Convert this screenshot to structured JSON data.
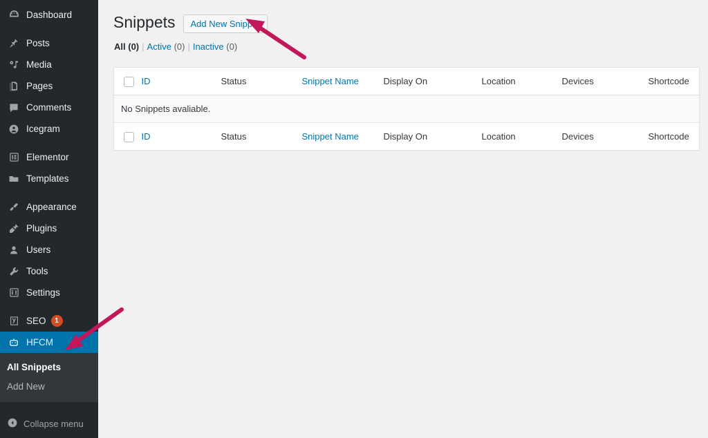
{
  "colors": {
    "sidebar_bg": "#23282d",
    "submenu_bg": "#32373c",
    "current_menu": "#0073aa",
    "link_blue": "#0073aa",
    "content_bg": "#f1f1f1",
    "badge_orange": "#d54e21",
    "annotation_arrow": "#c2185b"
  },
  "sidebar": {
    "items": [
      {
        "label": "Dashboard",
        "icon": "dashboard-icon",
        "gap_after": true
      },
      {
        "label": "Posts",
        "icon": "pin-icon",
        "gap_after": false
      },
      {
        "label": "Media",
        "icon": "media-icon",
        "gap_after": false
      },
      {
        "label": "Pages",
        "icon": "pages-icon",
        "gap_after": false
      },
      {
        "label": "Comments",
        "icon": "comment-icon",
        "gap_after": false
      },
      {
        "label": "Icegram",
        "icon": "icegram-icon",
        "gap_after": true
      },
      {
        "label": "Elementor",
        "icon": "elementor-icon",
        "gap_after": false
      },
      {
        "label": "Templates",
        "icon": "folder-icon",
        "gap_after": true
      },
      {
        "label": "Appearance",
        "icon": "brush-icon",
        "gap_after": false
      },
      {
        "label": "Plugins",
        "icon": "plugin-icon",
        "gap_after": false
      },
      {
        "label": "Users",
        "icon": "user-icon",
        "gap_after": false
      },
      {
        "label": "Tools",
        "icon": "wrench-icon",
        "gap_after": false
      },
      {
        "label": "Settings",
        "icon": "settings-icon",
        "gap_after": true
      },
      {
        "label": "SEO",
        "icon": "yoast-icon",
        "badge": "1",
        "gap_after": false
      },
      {
        "label": "HFCM",
        "icon": "hfcm-icon",
        "current": true,
        "gap_after": false
      }
    ],
    "submenu": [
      {
        "label": "All Snippets",
        "active": true
      },
      {
        "label": "Add New",
        "active": false
      }
    ],
    "collapse": {
      "label": "Collapse menu",
      "icon": "collapse-arrow-icon"
    }
  },
  "header": {
    "title": "Snippets",
    "add_new_label": "Add New Snippet"
  },
  "filters": [
    {
      "label": "All",
      "count": "(0)",
      "current": true
    },
    {
      "label": "Active",
      "count": "(0)",
      "current": false
    },
    {
      "label": "Inactive",
      "count": "(0)",
      "current": false
    }
  ],
  "table": {
    "columns": [
      {
        "label": "ID",
        "link": true
      },
      {
        "label": "Status",
        "link": false
      },
      {
        "label": "Snippet Name",
        "link": true
      },
      {
        "label": "Display On",
        "link": false
      },
      {
        "label": "Location",
        "link": false
      },
      {
        "label": "Devices",
        "link": false
      },
      {
        "label": "Shortcode",
        "link": false
      }
    ],
    "empty_message": "No Snippets avaliable."
  },
  "annotations": {
    "arrow_to_add_new": "arrow pointing up-left at Add New Snippet button",
    "arrow_to_hfcm": "arrow pointing down-left at HFCM menu item"
  }
}
